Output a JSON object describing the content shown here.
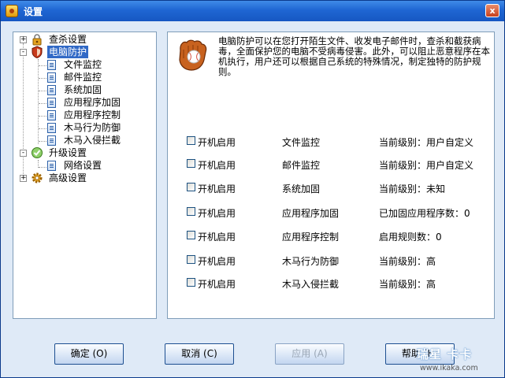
{
  "window": {
    "title": "设置",
    "close": "x"
  },
  "tree": {
    "nodes": [
      {
        "label": "查杀设置",
        "expander": "+"
      },
      {
        "label": "电脑防护",
        "expander": "-"
      },
      {
        "label": "文件监控"
      },
      {
        "label": "邮件监控"
      },
      {
        "label": "系统加固"
      },
      {
        "label": "应用程序加固"
      },
      {
        "label": "应用程序控制"
      },
      {
        "label": "木马行为防御"
      },
      {
        "label": "木马入侵拦截"
      },
      {
        "label": "升级设置",
        "expander": "-"
      },
      {
        "label": "网络设置"
      },
      {
        "label": "高级设置",
        "expander": "+"
      }
    ]
  },
  "main": {
    "description": "电脑防护可以在您打开陌生文件、收发电子邮件时，查杀和截获病毒，全面保护您的电脑不受病毒侵害。此外，可以阻止恶意程序在本机执行，用户还可以根据自己系统的特殊情况，制定独特的防护规则。",
    "rows": [
      {
        "checkbox": "开机启用",
        "feature": "文件监控",
        "status": "当前级别：用户自定义"
      },
      {
        "checkbox": "开机启用",
        "feature": "邮件监控",
        "status": "当前级别：用户自定义"
      },
      {
        "checkbox": "开机启用",
        "feature": "系统加固",
        "status": "当前级别：未知"
      },
      {
        "checkbox": "开机启用",
        "feature": "应用程序加固",
        "status": "已加固应用程序数：0"
      },
      {
        "checkbox": "开机启用",
        "feature": "应用程序控制",
        "status": "启用规则数：0"
      },
      {
        "checkbox": "开机启用",
        "feature": "木马行为防御",
        "status": "当前级别：高"
      },
      {
        "checkbox": "开机启用",
        "feature": "木马入侵拦截",
        "status": "当前级别：高"
      }
    ]
  },
  "buttons": {
    "ok": "确定 (O)",
    "cancel": "取消 (C)",
    "apply": "应用 (A)",
    "help": "帮助 (H)"
  },
  "watermark": {
    "big": "瑞星 卡卡",
    "small": "www.ikaka.com"
  }
}
